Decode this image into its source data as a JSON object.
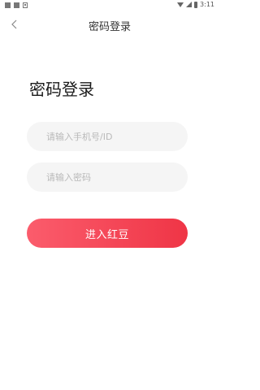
{
  "status_bar": {
    "time": "3:11"
  },
  "nav": {
    "back_icon": "chevron-left-icon",
    "title": "密码登录"
  },
  "page": {
    "title": "密码登录"
  },
  "form": {
    "phone": {
      "value": "",
      "placeholder": "请输入手机号/ID"
    },
    "password": {
      "value": "",
      "placeholder": "请输入密码"
    },
    "submit_label": "进入红豆"
  },
  "colors": {
    "accent_start": "#fb5c6c",
    "accent_end": "#ef3546",
    "field_bg": "#f5f5f5",
    "placeholder": "#b9b9b9"
  }
}
